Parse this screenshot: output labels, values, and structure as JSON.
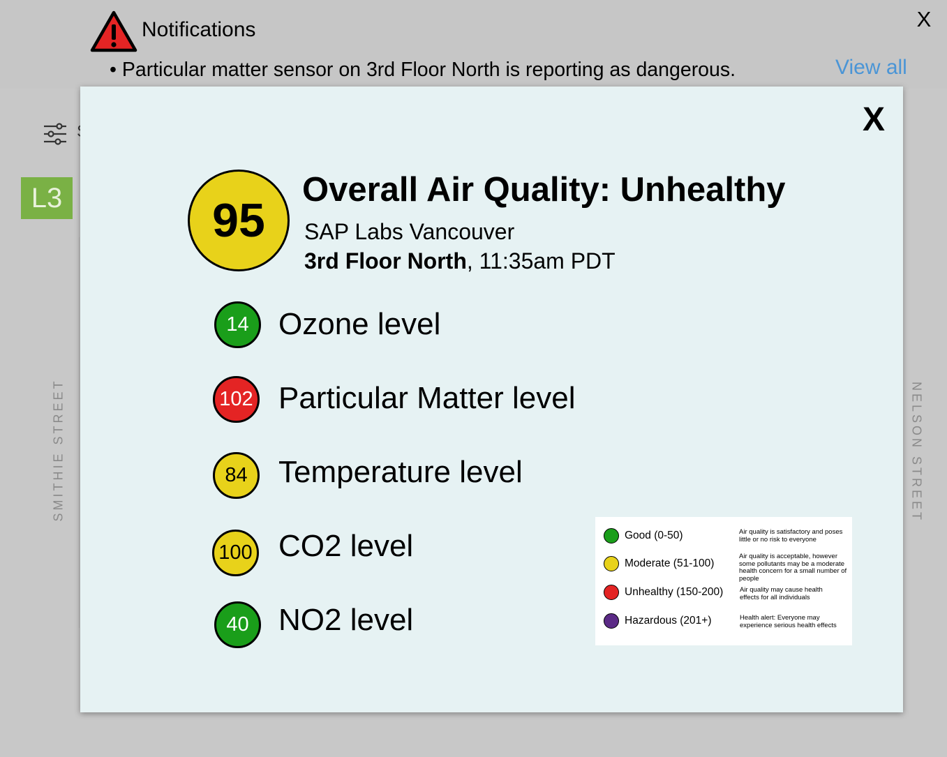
{
  "notifications": {
    "title": "Notifications",
    "close_label": "X",
    "message": "• Particular matter sensor on 3rd Floor North is reporting as dangerous.",
    "view_all_label": "View all"
  },
  "background": {
    "filter_label": "S",
    "floor_badge": "L3",
    "street_left": "SMITHIE STREET",
    "street_right": "NELSON STREET"
  },
  "modal": {
    "close_label": "X",
    "overall_score": "95",
    "title": "Overall Air Quality: Unhealthy",
    "organization": "SAP Labs Vancouver",
    "location": "3rd Floor North",
    "time": ", 11:35am PDT",
    "metrics": [
      {
        "value": "14",
        "label": "Ozone level",
        "color": "#1a9e1a",
        "text_color": "#ffffff"
      },
      {
        "value": "102",
        "label": "Particular Matter level",
        "color": "#e42424",
        "text_color": "#ffffff"
      },
      {
        "value": "84",
        "label": "Temperature level",
        "color": "#e8d21a",
        "text_color": "#000000"
      },
      {
        "value": "100",
        "label": "CO2 level",
        "color": "#e8d21a",
        "text_color": "#000000"
      },
      {
        "value": "40",
        "label": "NO2 level",
        "color": "#1a9e1a",
        "text_color": "#ffffff"
      }
    ],
    "legend": [
      {
        "name": "Good (0-50)",
        "color": "#1a9e1a",
        "description": "Air quality is satisfactory and poses little or no risk to everyone"
      },
      {
        "name": "Moderate (51-100)",
        "color": "#e8d21a",
        "description": "Air quality is acceptable, however some pollutants may be a moderate health concern for a small number of people"
      },
      {
        "name": "Unhealthy (150-200)",
        "color": "#e42424",
        "description": "Air quality may cause health effects for all individuals"
      },
      {
        "name": "Hazardous (201+)",
        "color": "#5b2a86",
        "description": "Health alert: Everyone may experience serious health effects"
      }
    ]
  },
  "colors": {
    "accent_link": "#4a95d6",
    "modal_bg": "#e6f2f3",
    "floor_badge_bg": "#7ab145",
    "warning_red": "#e42424"
  }
}
